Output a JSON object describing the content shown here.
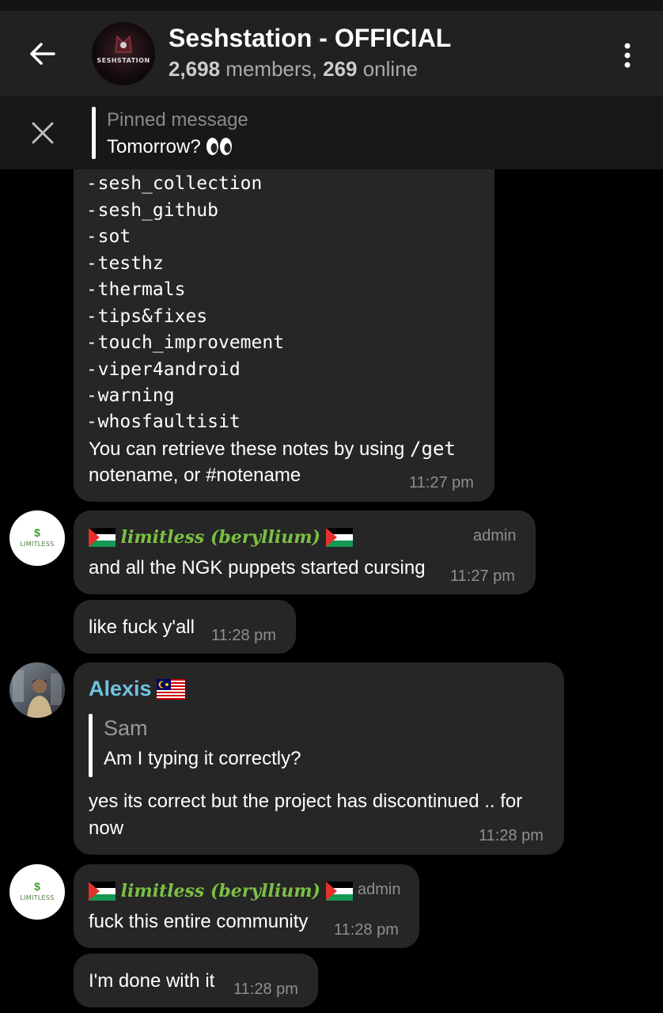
{
  "header": {
    "title": "Seshstation - OFFICIAL",
    "members_count": "2,698",
    "members_word": " members, ",
    "online_count": "269",
    "online_word": " online",
    "avatar_logo_text": "SESHSTATION"
  },
  "pinned": {
    "label": "Pinned message",
    "text": "Tomorrow?",
    "emoji": "eyes-emoji"
  },
  "notes_message": {
    "lines": [
      "sesh_collection",
      "sesh_github",
      "sot",
      "testhz",
      "thermals",
      "tips&fixes",
      "touch_improvement",
      "viper4android",
      "warning",
      "whosfaultisit"
    ],
    "footer_1a": "You can retrieve these notes by using ",
    "footer_1b": "/get",
    "footer_2": "notename, or #notename",
    "time": "11:27 pm"
  },
  "messages": [
    {
      "sender": "limitless (beryllium)",
      "badge": "admin",
      "text": "and all the NGK puppets started cursing",
      "time": "11:27 pm"
    },
    {
      "text": "like fuck y'all",
      "time": "11:28 pm"
    },
    {
      "sender": "Alexis",
      "reply_to": {
        "name": "Sam",
        "text": "Am I typing it correctly?"
      },
      "text_1": "yes its correct but the project has discontinued .. for",
      "text_2": "now",
      "time": "11:28 pm"
    },
    {
      "sender": "limitless (beryllium)",
      "badge": "admin",
      "text": "fuck this entire community",
      "time": "11:28 pm"
    },
    {
      "text": "I'm done with it",
      "time": "11:28 pm"
    }
  ],
  "avatars": {
    "limitless_text": "LIMITLESS",
    "limitless_symbol": "$"
  },
  "colors": {
    "background": "#000000",
    "header": "#212121",
    "bubble": "#262626",
    "limitless_name": "#7bc043",
    "alexis_name": "#6fc3e0"
  }
}
